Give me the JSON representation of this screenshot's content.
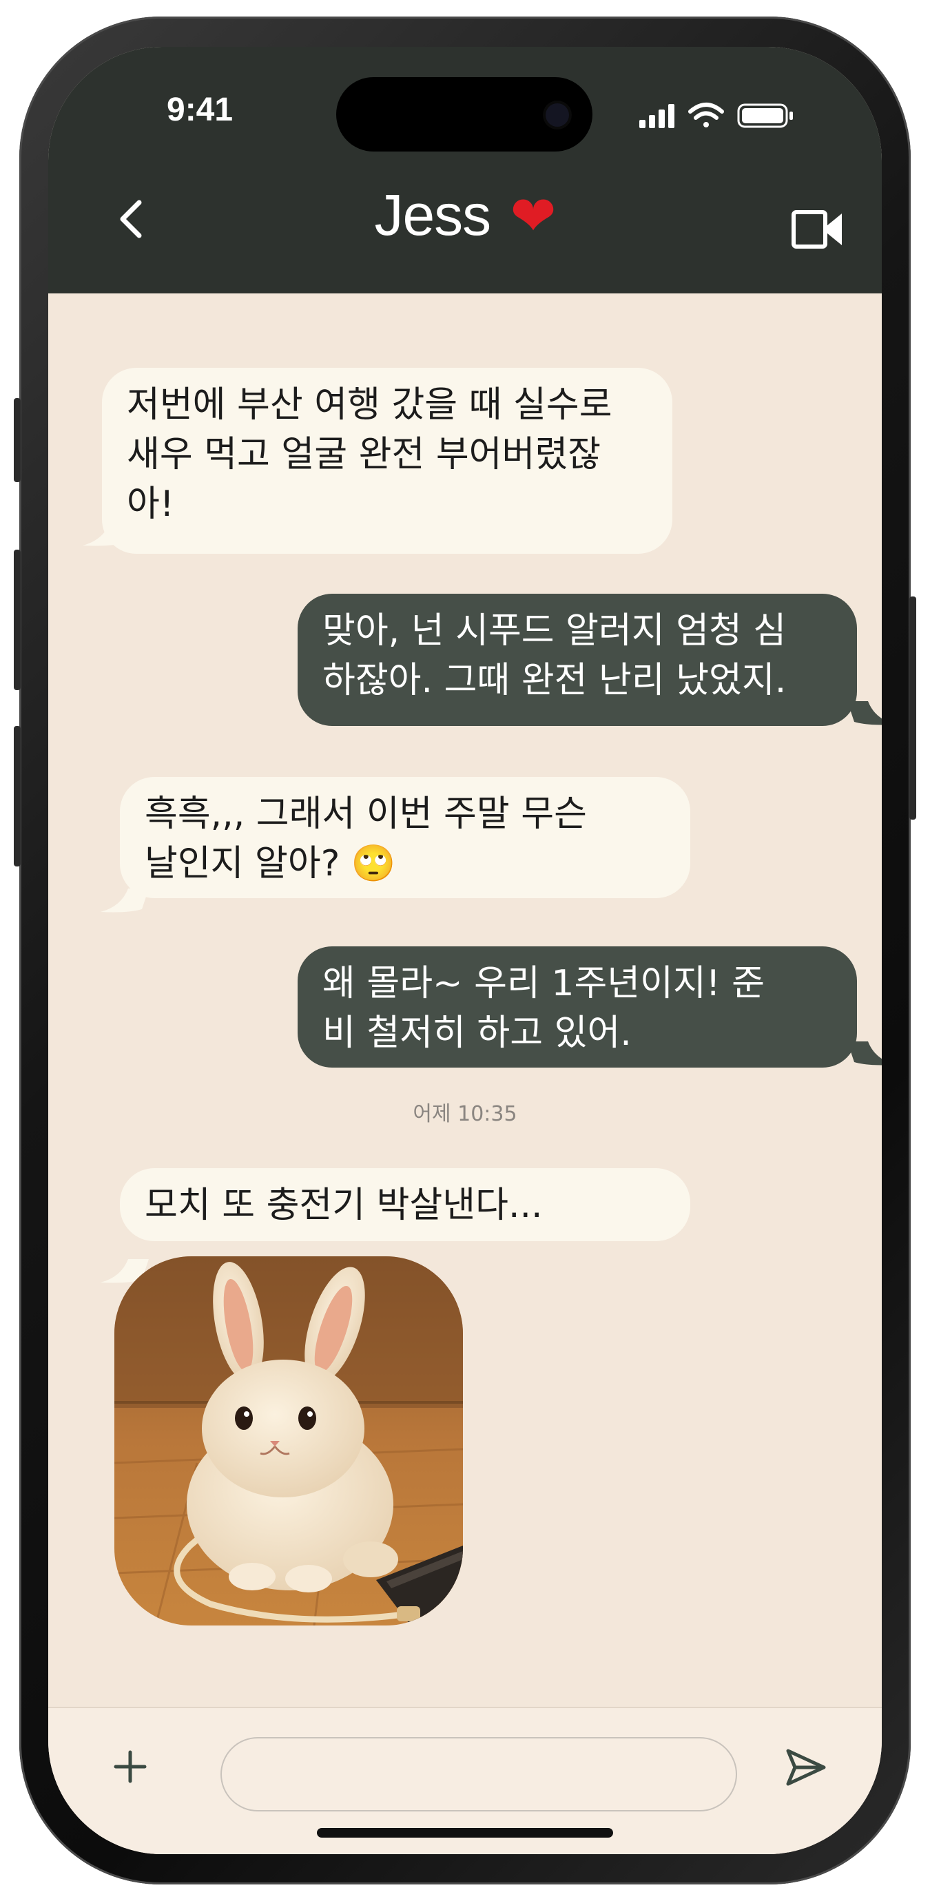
{
  "status_bar": {
    "time": "9:41"
  },
  "header": {
    "contact_name": "Jess",
    "heart": "❤",
    "back_icon": "chevron-left-icon",
    "video_icon": "video-camera-icon"
  },
  "messages": [
    {
      "direction": "incoming",
      "text": "저번에 부산 여행 갔을 때 실수로\n새우 먹고 얼굴 완전 부어버렸잖\n아!"
    },
    {
      "direction": "outgoing",
      "text": "맞아, 넌 시푸드 알러지 엄청 심\n하잖아. 그때 완전 난리 났었지."
    },
    {
      "direction": "incoming",
      "text": "흑흑,,, 그래서 이번 주말 무슨\n날인지 알아? 🙄"
    },
    {
      "direction": "outgoing",
      "text": "왜 몰라~ 우리 1주년이지! 준\n비 철저히 하고 있어."
    },
    {
      "direction": "incoming",
      "text": "모치 또 충전기 박살낸다..."
    }
  ],
  "timestamp": "어제 10:35",
  "photo": {
    "description_icon": "bunny-photo"
  },
  "input": {
    "placeholder": "",
    "plus_icon": "plus-icon",
    "send_icon": "send-icon"
  },
  "colors": {
    "header_bg": "#2d322e",
    "chat_bg": "#f3e7da",
    "incoming_bubble": "#fbf7ec",
    "outgoing_bubble": "#464f48"
  }
}
